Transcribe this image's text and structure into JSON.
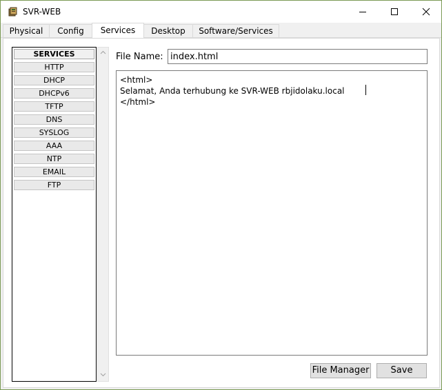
{
  "window": {
    "title": "SVR-WEB"
  },
  "tabs": [
    {
      "label": "Physical"
    },
    {
      "label": "Config"
    },
    {
      "label": "Services"
    },
    {
      "label": "Desktop"
    },
    {
      "label": "Software/Services"
    }
  ],
  "services": {
    "header": "SERVICES",
    "items": [
      "HTTP",
      "DHCP",
      "DHCPv6",
      "TFTP",
      "DNS",
      "SYSLOG",
      "AAA",
      "NTP",
      "EMAIL",
      "FTP"
    ]
  },
  "file": {
    "label": "File Name:",
    "name": "index.html",
    "lines": [
      "<html>",
      "Selamat, Anda terhubung ke SVR-WEB rbjidolaku.local",
      "</html>"
    ]
  },
  "buttons": {
    "file_manager": "File Manager",
    "save": "Save"
  },
  "icons": {
    "app": "packet-tracer-server-icon",
    "minimize": "minimize-icon",
    "maximize": "maximize-icon",
    "close": "close-icon"
  }
}
